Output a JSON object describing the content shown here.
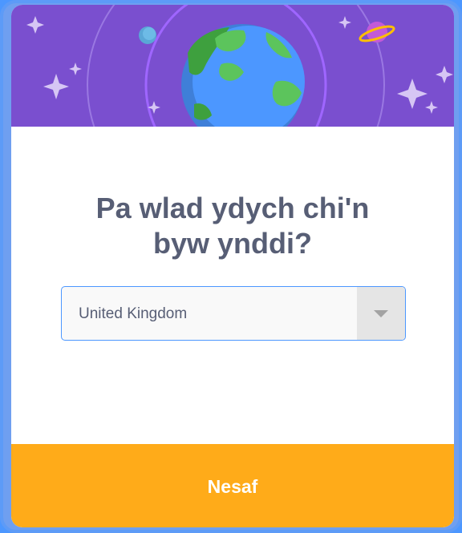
{
  "dialog": {
    "question": "Pa wlad ydych chi'n byw ynddi?",
    "country_select": {
      "selected_value": "United Kingdom"
    },
    "next_button_label": "Nesaf"
  },
  "colors": {
    "hero_background": "#7a4fcf",
    "frame": "#5d9bf7",
    "title_text": "#575e75",
    "next_button": "#ffab19"
  },
  "icons": [
    "earth-icon",
    "planet-icon",
    "moon-icon",
    "star-icon",
    "chevron-down-icon"
  ]
}
